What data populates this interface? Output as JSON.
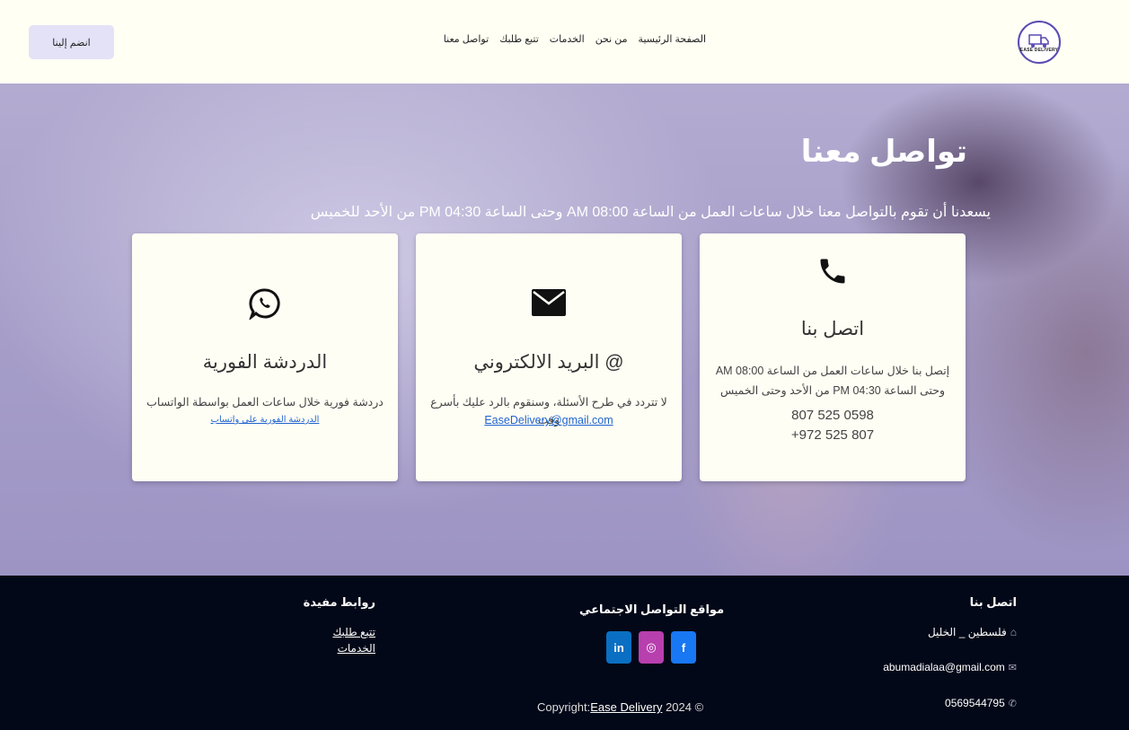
{
  "nav": {
    "logo_text": "EASE DELIVERY",
    "links": [
      "الصفحة الرئيسية",
      "من نحن",
      "الخدمات",
      "تتبع طلبك",
      "تواصل معنا"
    ],
    "join_label": "انضم إلينا"
  },
  "hero": {
    "title": "تواصل معنا",
    "subtitle": "يسعدنا أن تقوم بالتواصل معنا خلال ساعات العمل من الساعة 08:00 AM وحتى الساعة 04:30 PM من الأحد للخميس"
  },
  "cards": {
    "call": {
      "icon": "phone-icon",
      "title": "اتصل بنا",
      "line1": "إتصل بنا خلال ساعات العمل من الساعة 08:00 AM",
      "line2": "وحتى الساعة 04:30 PM من الأحد وحتى الخميس",
      "phone1": "0598 525 807",
      "phone2": "807 525 972+"
    },
    "email": {
      "icon": "envelope-icon",
      "title": "@ البريد الالكتروني",
      "text": "لا تتردد في طرح الأسئلة، وسنقوم بالرد عليك بأسرع وقت",
      "link": "EaseDelivery@gmail.com"
    },
    "chat": {
      "icon": "whatsapp-icon",
      "title": "الدردشة الفورية",
      "text": "دردشة فورية خلال ساعات العمل بواسطة الواتساب",
      "link": "الدردشة الفورية على واتساب"
    }
  },
  "footer": {
    "contact_heading": "اتصل بنا",
    "address": "فلسطين _ الخليل",
    "email": "abumadialaa@gmail.com",
    "phone": "0569544795",
    "social_heading": "مواقع التواصل الاجتماعي",
    "social": [
      {
        "name": "facebook-icon",
        "glyph": "f",
        "color": "#1877f2"
      },
      {
        "name": "instagram-icon",
        "glyph": "◎",
        "color": "#b83fae"
      },
      {
        "name": "linkedin-icon",
        "glyph": "in",
        "color": "#0a6fc2"
      }
    ],
    "links_heading": "روابط مفيدة",
    "links": [
      "تتبع طلبك",
      "الخدمات"
    ],
    "copyright_prefix": "Copyright:",
    "copyright_brand": "Ease Delivery",
    "copyright_suffix": " 2024 ©"
  },
  "colors": {
    "accent": "#5a4bb3",
    "footer_bg": "#030818",
    "hero_tint": "#a79fc9",
    "card_bg": "#fffef4",
    "link": "#1f63d0"
  }
}
